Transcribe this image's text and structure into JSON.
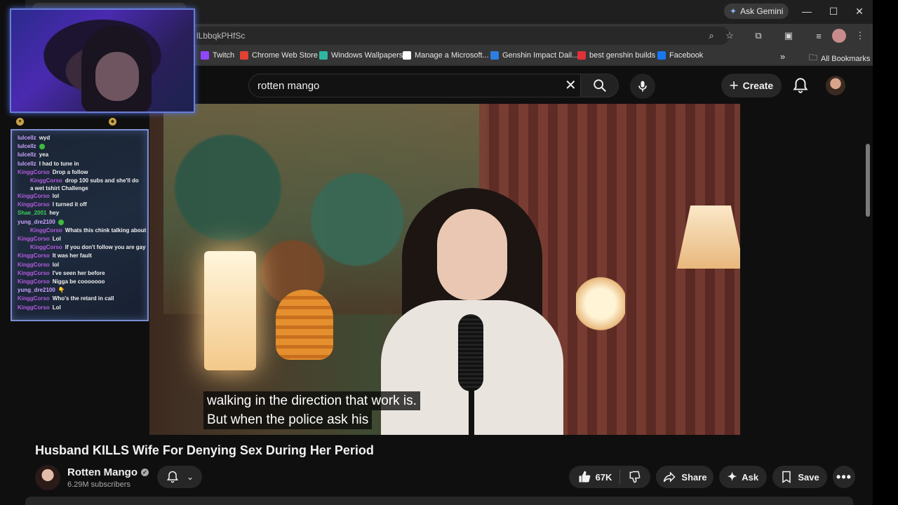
{
  "browser": {
    "url_partial": "lLbbqkPHfSc",
    "gemini_label": "Ask Gemini",
    "bookmarks": [
      {
        "label": "Twitch",
        "color": "#9146ff"
      },
      {
        "label": "Chrome Web Store",
        "color": "#e34133"
      },
      {
        "label": "Windows Wallpapers",
        "color": "#2fb5a3"
      },
      {
        "label": "Manage a Microsoft...",
        "color": "#ffffff"
      },
      {
        "label": "Genshin Impact Dail...",
        "color": "#2d7de0"
      },
      {
        "label": "best genshin builds",
        "color": "#e0303a"
      },
      {
        "label": "Facebook",
        "color": "#1877f2"
      }
    ],
    "all_bookmarks": "All Bookmarks"
  },
  "youtube": {
    "search_query": "rotten mango",
    "create_label": "Create",
    "captions": [
      "walking in the direction that work is.",
      "But when the police ask his"
    ],
    "video_title": "Husband KILLS Wife For Denying Sex During Her Period",
    "channel_name": "Rotten Mango",
    "subscribers": "6.29M subscribers",
    "like_count": "67K",
    "share_label": "Share",
    "ask_label": "Ask",
    "save_label": "Save"
  },
  "chat": {
    "messages": [
      {
        "user": "lulcellz",
        "color": "#c9a4ff",
        "text": "wyd"
      },
      {
        "user": "lulcellz",
        "color": "#c9a4ff",
        "text": "",
        "emote": true
      },
      {
        "user": "lulcellz",
        "color": "#c9a4ff",
        "text": "yea"
      },
      {
        "user": "lulcellz",
        "color": "#c9a4ff",
        "text": "I had to tune in"
      },
      {
        "user": "KinggCorso",
        "color": "#b45ce0",
        "text": "Drop a follow"
      },
      {
        "user": "KinggCorso",
        "color": "#b45ce0",
        "text": "drop 100 subs and she'll do a wet tshirt Challenge",
        "wrap": true
      },
      {
        "user": "KinggCorso",
        "color": "#b45ce0",
        "text": "lol"
      },
      {
        "user": "KinggCorso",
        "color": "#b45ce0",
        "text": "I turned it off"
      },
      {
        "user": "Shae_2001",
        "color": "#3fcf5a",
        "text": "hey"
      },
      {
        "user": "yung_dre2100",
        "color": "#c9a4ff",
        "text": "",
        "emote": true
      },
      {
        "user": "KinggCorso",
        "color": "#b45ce0",
        "text": "Whats this chink talking about",
        "indent": true
      },
      {
        "user": "KinggCorso",
        "color": "#b45ce0",
        "text": "Lol"
      },
      {
        "user": "KinggCorso",
        "color": "#b45ce0",
        "text": "If you don't follow you are gay",
        "indent": true
      },
      {
        "user": "KinggCorso",
        "color": "#b45ce0",
        "text": "It was her fault"
      },
      {
        "user": "KinggCorso",
        "color": "#b45ce0",
        "text": "lol"
      },
      {
        "user": "KinggCorso",
        "color": "#b45ce0",
        "text": "I've seen her before"
      },
      {
        "user": "KinggCorso",
        "color": "#b45ce0",
        "text": "Nigga be cooooooo"
      },
      {
        "user": "yung_dre2100",
        "color": "#c9a4ff",
        "text": "👇"
      },
      {
        "user": "KinggCorso",
        "color": "#b45ce0",
        "text": "Who's the retard in call"
      },
      {
        "user": "KinggCorso",
        "color": "#b45ce0",
        "text": "Lol"
      }
    ]
  }
}
